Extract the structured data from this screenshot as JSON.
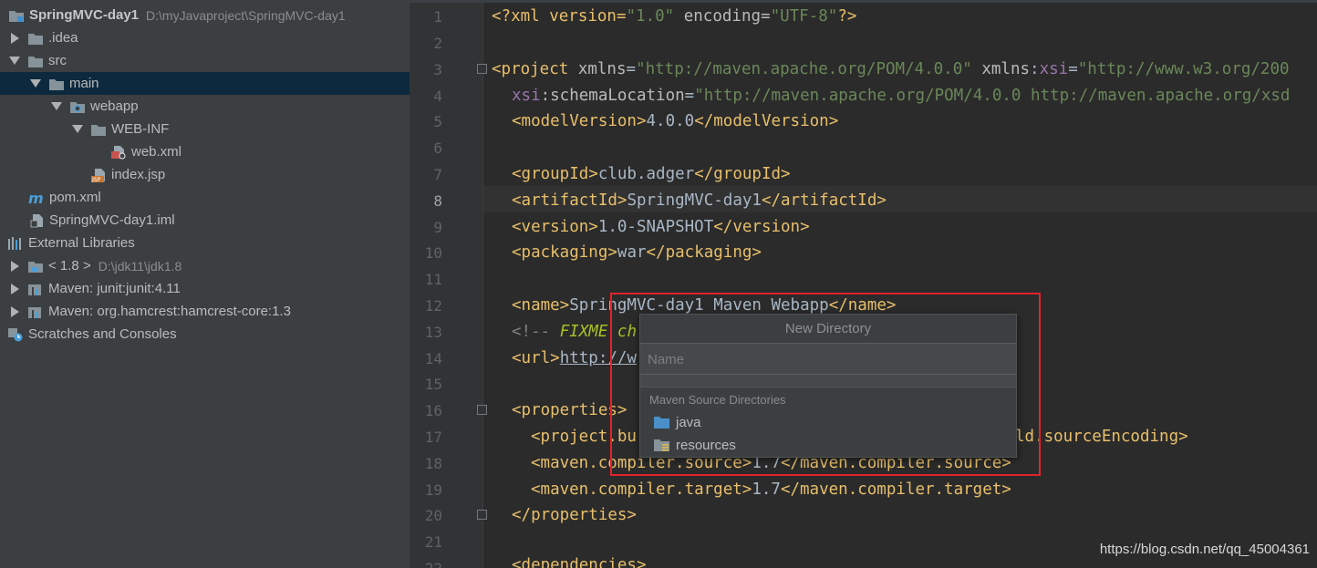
{
  "project_tree": {
    "root": {
      "label": "SpringMVC-day1",
      "path": "D:\\myJavaproject\\SpringMVC-day1"
    },
    "items": [
      {
        "label": ".idea"
      },
      {
        "label": "src"
      },
      {
        "label": "main"
      },
      {
        "label": "webapp"
      },
      {
        "label": "WEB-INF"
      },
      {
        "label": "web.xml"
      },
      {
        "label": "index.jsp"
      },
      {
        "label": "pom.xml"
      },
      {
        "label": "SpringMVC-day1.iml"
      },
      {
        "label": "External Libraries"
      },
      {
        "label": "< 1.8 >",
        "path": "D:\\jdk11\\jdk1.8"
      },
      {
        "label": "Maven: junit:junit:4.11"
      },
      {
        "label": "Maven: org.hamcrest:hamcrest-core:1.3"
      },
      {
        "label": "Scratches and Consoles"
      }
    ]
  },
  "editor": {
    "line_numbers": [
      "1",
      "2",
      "3",
      "4",
      "5",
      "6",
      "7",
      "8",
      "9",
      "10",
      "11",
      "12",
      "13",
      "14",
      "15",
      "16",
      "17",
      "18",
      "19",
      "20",
      "21",
      "22"
    ],
    "current_line": "8",
    "code": {
      "l1": {
        "a": "<?xml version=",
        "b": "\"1.0\"",
        "c": " encoding=",
        "d": "\"UTF-8\"",
        "e": "?>"
      },
      "l3": {
        "a": "<project ",
        "b": "xmlns",
        "c": "=",
        "d": "\"http://maven.apache.org/POM/4.0.0\"",
        "e": " xmlns",
        "f": ":",
        "g": "xsi",
        "h": "=",
        "i": "\"http://www.w3.org/200"
      },
      "l4": {
        "a": "xsi",
        "b": ":schemaLocation",
        "c": "=",
        "d": "\"http://maven.apache.org/POM/4.0.0 http://maven.apache.org/xsd"
      },
      "l5": {
        "a": "<modelVersion>",
        "b": "4.0.0",
        "c": "</modelVersion>"
      },
      "l7": {
        "a": "<groupId>",
        "b": "club.adger",
        "c": "</groupId>"
      },
      "l8": {
        "a": "<artifactId>",
        "b": "SpringMVC-day1",
        "c": "</artifactId>"
      },
      "l9": {
        "a": "<version>",
        "b": "1.0-SNAPSHOT",
        "c": "</version>"
      },
      "l10": {
        "a": "<packaging>",
        "b": "war",
        "c": "</packaging>"
      },
      "l12": {
        "a": "<name>",
        "b": "SpringMVC-day1 Maven Webapp",
        "c": "</name>"
      },
      "l13": {
        "a": "<!-- ",
        "b": "FIXME ch"
      },
      "l14": {
        "a": "<url>",
        "b": "http://w"
      },
      "l16": {
        "a": "<properties>"
      },
      "l17": {
        "a": "<project.bu",
        "b": "ld.sourceEncoding>"
      },
      "l18": {
        "a": "<maven.compiler.source>",
        "b": "1.7",
        "c": "</maven.compiler.source>"
      },
      "l19": {
        "a": "<maven.compiler.target>",
        "b": "1.7",
        "c": "</maven.compiler.target>"
      },
      "l20": {
        "a": "</properties>"
      },
      "l22": {
        "a": "<dependencies>"
      }
    }
  },
  "popup": {
    "title": "New Directory",
    "input_placeholder": "Name",
    "input_value": "",
    "group_label": "Maven Source Directories",
    "items": [
      {
        "label": "java",
        "icon": "source-folder-icon"
      },
      {
        "label": "resources",
        "icon": "resources-folder-icon"
      }
    ]
  },
  "watermark": "https://blog.csdn.net/qq_45004361",
  "colors": {
    "highlight": "#e3232a",
    "tree_selected": "#0d293e",
    "tag": "#e8bf6a",
    "string": "#6a8759",
    "namespace": "#9876aa"
  }
}
